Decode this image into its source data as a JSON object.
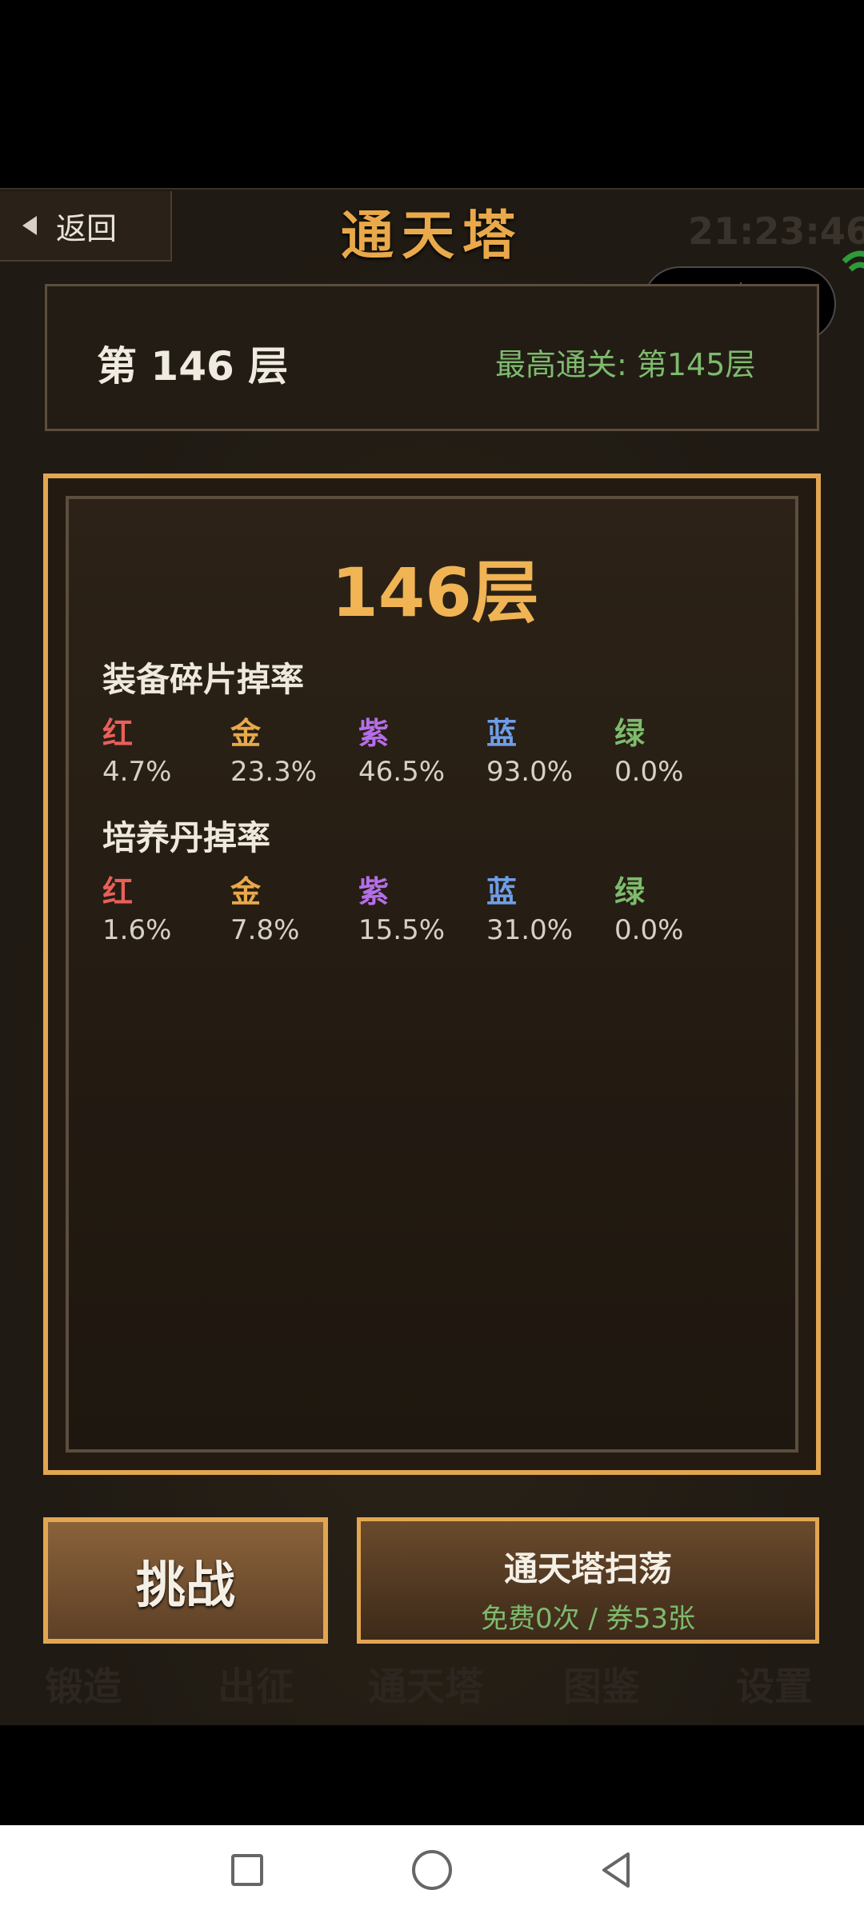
{
  "header": {
    "back_label": "返回",
    "title": "通天塔",
    "clock": "21:23:46"
  },
  "floor_panel": {
    "current_floor": "第 146 层",
    "best_clear": "最高通关: 第145层"
  },
  "card": {
    "title": "146层",
    "equipment_section": {
      "title": "装备碎片掉率",
      "rates": [
        {
          "name": "红",
          "value": "4.7%",
          "color": "#e8605a"
        },
        {
          "name": "金",
          "value": "23.3%",
          "color": "#e9a94a"
        },
        {
          "name": "紫",
          "value": "46.5%",
          "color": "#b56ee8"
        },
        {
          "name": "蓝",
          "value": "93.0%",
          "color": "#6f9ee8"
        },
        {
          "name": "绿",
          "value": "0.0%",
          "color": "#7dbb6d"
        }
      ]
    },
    "pill_section": {
      "title": "培养丹掉率",
      "rates": [
        {
          "name": "红",
          "value": "1.6%",
          "color": "#e8605a"
        },
        {
          "name": "金",
          "value": "7.8%",
          "color": "#e9a94a"
        },
        {
          "name": "紫",
          "value": "15.5%",
          "color": "#b56ee8"
        },
        {
          "name": "蓝",
          "value": "31.0%",
          "color": "#6f9ee8"
        },
        {
          "name": "绿",
          "value": "0.0%",
          "color": "#7dbb6d"
        }
      ]
    }
  },
  "buttons": {
    "challenge": "挑战",
    "sweep_title": "通天塔扫荡",
    "sweep_sub": "免费0次 / 券53张"
  },
  "bottom_nav_faded": [
    "锻造",
    "出征",
    "通天塔",
    "图鉴",
    "设置"
  ]
}
